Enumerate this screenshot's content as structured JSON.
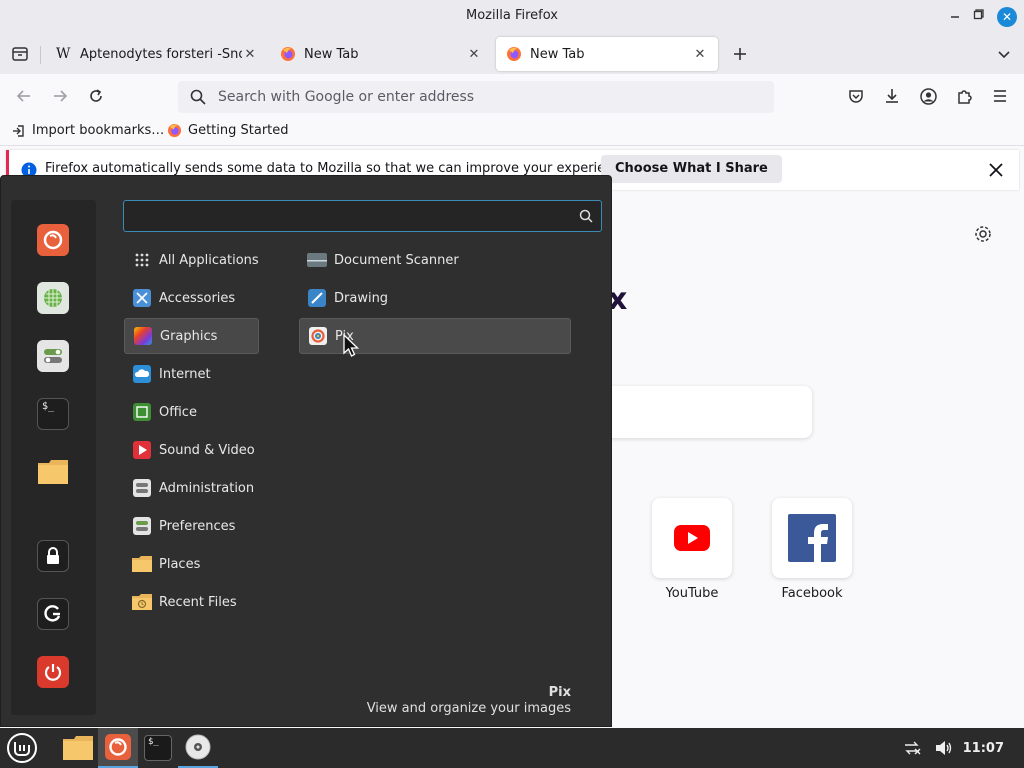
{
  "window": {
    "title": "Mozilla Firefox",
    "minimize_icon": "minimize-icon",
    "maximize_icon": "maximize-icon",
    "close_icon": "close-icon"
  },
  "tabs": [
    {
      "label": "Aptenodytes forsteri -Snow",
      "active": false
    },
    {
      "label": "New Tab",
      "active": false
    },
    {
      "label": "New Tab",
      "active": true
    }
  ],
  "navbar": {
    "url_placeholder": "Search with Google or enter address"
  },
  "bookmarks": [
    {
      "label": "Import bookmarks…"
    },
    {
      "label": "Getting Started"
    }
  ],
  "notice": {
    "text": "Firefox automatically sends some data to Mozilla so that we can improve your experience.",
    "button": "Choose What I Share"
  },
  "newtab": {
    "brand_fragment": "x",
    "shortcuts": [
      {
        "label": "YouTube"
      },
      {
        "label": "Facebook"
      }
    ]
  },
  "menu": {
    "search_value": "",
    "categories": [
      {
        "label": "All Applications",
        "selected": false
      },
      {
        "label": "Accessories",
        "selected": false
      },
      {
        "label": "Graphics",
        "selected": true
      },
      {
        "label": "Internet",
        "selected": false
      },
      {
        "label": "Office",
        "selected": false
      },
      {
        "label": "Sound & Video",
        "selected": false
      },
      {
        "label": "Administration",
        "selected": false
      },
      {
        "label": "Preferences",
        "selected": false
      },
      {
        "label": "Places",
        "selected": false
      },
      {
        "label": "Recent Files",
        "selected": false
      }
    ],
    "apps": [
      {
        "label": "Document Scanner",
        "hover": false
      },
      {
        "label": "Drawing",
        "hover": false
      },
      {
        "label": "Pix",
        "hover": true
      }
    ],
    "description": {
      "name": "Pix",
      "text": "View and organize your images"
    },
    "favorites": [
      "firefox-icon",
      "network-icon",
      "settings-toggle-icon",
      "terminal-icon",
      "folder-icon",
      "lock-icon",
      "logout-icon",
      "power-icon"
    ]
  },
  "taskbar": {
    "clock": "11:07",
    "items": [
      "mint-menu-icon",
      "files-icon",
      "firefox-icon",
      "terminal-icon",
      "disc-icon"
    ]
  },
  "colors": {
    "accent": "#1a8ad8",
    "menu_bg": "#2f2f2f",
    "notice_border": "#e22850"
  }
}
